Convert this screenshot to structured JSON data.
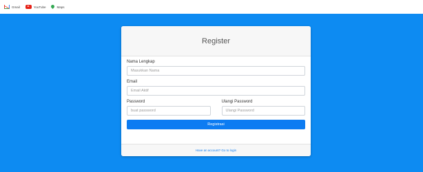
{
  "bookmarks": [
    {
      "label": "Gmail",
      "icon": "gmail-icon"
    },
    {
      "label": "YouTube",
      "icon": "youtube-icon"
    },
    {
      "label": "Maps",
      "icon": "maps-icon"
    }
  ],
  "colors": {
    "background": "#0d8bf2",
    "button": "#0d7cf2"
  },
  "form": {
    "title": "Register",
    "name": {
      "label": "Nama Lengkap",
      "placeholder": "Masukkan Nama"
    },
    "email": {
      "label": "Email",
      "placeholder": "Email Aktif"
    },
    "password": {
      "label": "Password",
      "placeholder": "buat password"
    },
    "confirm": {
      "label": "Ulangi Password",
      "placeholder": "Ulangi Password"
    },
    "submit_label": "Registrasi",
    "login_link": "Have an account? Go to login"
  }
}
